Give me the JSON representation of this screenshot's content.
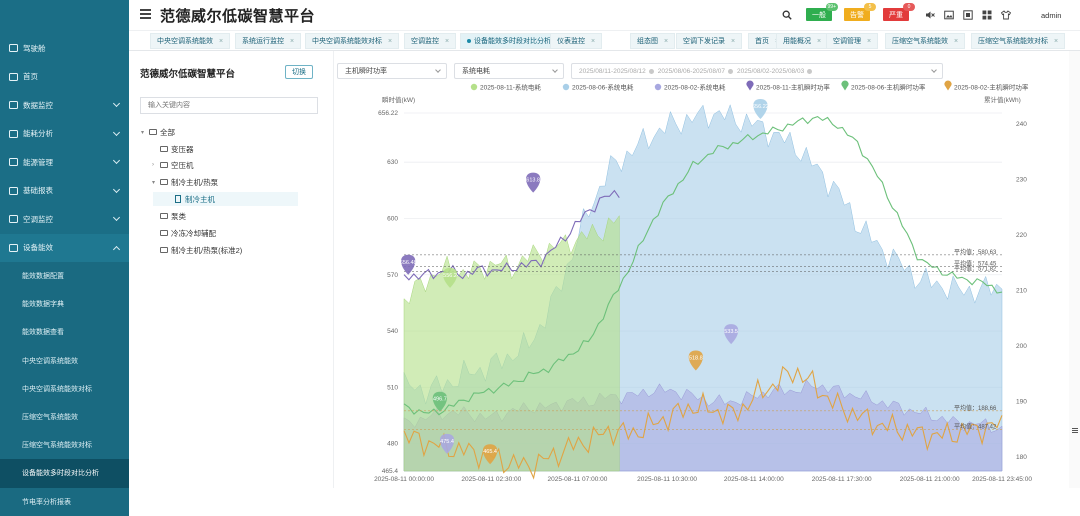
{
  "app": {
    "title": "范德威尔低碳智慧平台",
    "user": "admin"
  },
  "sidebar": {
    "items": [
      {
        "label": "驾驶舱",
        "icon": "dashboard-icon"
      },
      {
        "label": "首页",
        "icon": "home-icon"
      },
      {
        "label": "数据监控",
        "icon": "monitor-icon"
      },
      {
        "label": "能耗分析",
        "icon": "chart-icon"
      },
      {
        "label": "能源管理",
        "icon": "energy-icon"
      },
      {
        "label": "基础报表",
        "icon": "report-icon"
      },
      {
        "label": "空调监控",
        "icon": "snowflake-icon"
      },
      {
        "label": "设备能效",
        "icon": "device-icon"
      }
    ],
    "sub_items": [
      "能效数据配置",
      "能效数据字典",
      "能效数据查看",
      "中央空调系统能效",
      "中央空调系统能效对标",
      "压缩空气系统能效",
      "压缩空气系统能效对标",
      "设备能效多时段对比分析",
      "节电率分析报表"
    ],
    "active_sub": "设备能效多时段对比分析"
  },
  "header": {
    "alarms": [
      {
        "label": "一般",
        "count": "99+",
        "color": "#2fae4f"
      },
      {
        "label": "告警",
        "count": "5",
        "color": "#f0ad1e"
      },
      {
        "label": "严重",
        "count": "0",
        "color": "#e23b3b"
      }
    ],
    "icons": [
      "search-icon",
      "mute-icon",
      "image-icon",
      "fullscreen-icon",
      "grid-icon",
      "shirt-icon"
    ]
  },
  "tabs": [
    {
      "label": "中央空调系统能效",
      "active": false
    },
    {
      "label": "系统运行监控",
      "active": false
    },
    {
      "label": "中央空调系统能效对标",
      "active": false
    },
    {
      "label": "空调监控",
      "active": false
    },
    {
      "label": "设备能效多时段对比分析",
      "active": true
    },
    {
      "label": "仪表监控",
      "active": false
    },
    {
      "label": "组态图",
      "active": false
    },
    {
      "label": "空调下发记录",
      "active": false
    },
    {
      "label": "首页",
      "active": false
    },
    {
      "label": "用能概况",
      "active": false
    },
    {
      "label": "空调管理",
      "active": false
    },
    {
      "label": "压缩空气系统能效",
      "active": false
    },
    {
      "label": "压缩空气系统能效对标",
      "active": false
    }
  ],
  "tree": {
    "title": "范德威尔低碳智慧平台",
    "switch_label": "切换",
    "search_placeholder": "输入关键内容",
    "nodes": [
      {
        "label": "全部",
        "caret": "▾",
        "level": 0
      },
      {
        "label": "变压器",
        "caret": "",
        "level": 1
      },
      {
        "label": "空压机",
        "caret": "›",
        "level": 1
      },
      {
        "label": "制冷主机/热泵",
        "caret": "▾",
        "level": 1
      },
      {
        "label": "制冷主机",
        "caret": "",
        "level": 2,
        "leaf": true,
        "selected": true
      },
      {
        "label": "泵类",
        "caret": "",
        "level": 1
      },
      {
        "label": "冷冻冷却辅配",
        "caret": "",
        "level": 1
      },
      {
        "label": "制冷主机/热泵(标准2)",
        "caret": "",
        "level": 1
      }
    ]
  },
  "filters": {
    "metric_select": "主机瞬时功率",
    "metric2_select": "系统电耗",
    "date_ranges": [
      "2025/08/11-2025/08/12",
      "2025/08/06-2025/08/07",
      "2025/08/02-2025/08/03"
    ]
  },
  "chart_data": {
    "type": "line",
    "left_axis_label": "瞬时值(kW)",
    "right_axis_label": "累计值(kWh)",
    "left_ticks": [
      "656.22",
      "630",
      "600",
      "570",
      "540",
      "510",
      "480",
      "465.4"
    ],
    "left_tick_values": [
      656.22,
      630,
      600,
      570,
      540,
      510,
      480,
      465.4
    ],
    "left_range": [
      465.4,
      656.22
    ],
    "right_ticks": [
      "240",
      "230",
      "220",
      "210",
      "200",
      "190",
      "180"
    ],
    "right_range": [
      177.5,
      242
    ],
    "x_labels": [
      "2025-08-11 00:00:00",
      "2025-08-11 02:30:00",
      "2025-08-11 07:00:00",
      "2025-08-11 10:30:00",
      "2025-08-11 14:00:00",
      "2025-08-11 17:30:00",
      "2025-08-11 21:00:00",
      "2025-08-11 23:45:00"
    ],
    "legend": [
      {
        "name": "2025-08-11-系统电耗",
        "color": "#b5e08a",
        "type": "area"
      },
      {
        "name": "2025-08-06-系统电耗",
        "color": "#a9cfe8",
        "type": "area"
      },
      {
        "name": "2025-08-02-系统电耗",
        "color": "#a8a8e0",
        "type": "area"
      },
      {
        "name": "2025-08-11-主机瞬时功率",
        "color": "#7e6bb8",
        "type": "line"
      },
      {
        "name": "2025-08-06-主机瞬时功率",
        "color": "#6cc07a",
        "type": "line"
      },
      {
        "name": "2025-08-02-主机瞬时功率",
        "color": "#e0a444",
        "type": "line"
      }
    ],
    "markers": [
      {
        "text": "613.8",
        "color": "#7e6bb8",
        "t": 0.216,
        "v": 613.8
      },
      {
        "text": "656.22",
        "color": "#a9cfe8",
        "t": 0.596,
        "v": 653
      },
      {
        "text": "656.48",
        "color": "#7e6bb8",
        "t": 0.007,
        "v": 570
      },
      {
        "text": "556.2",
        "color": "#b5e08a",
        "t": 0.077,
        "v": 563
      },
      {
        "text": "496.7",
        "color": "#6cc07a",
        "t": 0.06,
        "v": 497
      },
      {
        "text": "475.4",
        "color": "#a8a8e0",
        "t": 0.072,
        "v": 474.5
      },
      {
        "text": "465.4",
        "color": "#e0a444",
        "t": 0.144,
        "v": 469
      },
      {
        "text": "518.8",
        "color": "#e0a444",
        "t": 0.488,
        "v": 519
      },
      {
        "text": "533.5",
        "color": "#a8a8e0",
        "t": 0.547,
        "v": 533
      }
    ],
    "avg_lines": [
      {
        "text": "平均值：580.63",
        "v": 580.6
      },
      {
        "text": "平均值：574.45",
        "v": 574.4
      },
      {
        "text": "平均值：571.82",
        "v": 571.8
      },
      {
        "text": "平均值：188.66",
        "v": 497.5
      },
      {
        "text": "平均值：487.42",
        "v": 487.4
      }
    ],
    "series_hourly": {
      "s0811_power": [
        570,
        569,
        571,
        572,
        570,
        573,
        572,
        574,
        575,
        578,
        586,
        595,
        604,
        611,
        614
      ],
      "s0806_power": [
        500,
        496,
        498,
        504,
        508,
        511,
        516,
        520,
        527,
        535,
        555,
        575,
        598,
        614,
        628,
        636,
        640,
        644,
        647,
        651,
        654,
        650,
        640,
        622,
        600,
        578,
        572,
        568,
        566,
        561
      ],
      "s0802_power": [
        484,
        481,
        478,
        476,
        474,
        470,
        468,
        472,
        478,
        482,
        487,
        485,
        490,
        495,
        500,
        498,
        495,
        505,
        512,
        519,
        510,
        500,
        495,
        490,
        488,
        485,
        484,
        486,
        488,
        490
      ],
      "s0811_cum": [
        208,
        211,
        213,
        214,
        213,
        214,
        215,
        214,
        216,
        217,
        218,
        219,
        220,
        221,
        223
      ],
      "s0806_cum": [
        193,
        192,
        193,
        195,
        196,
        198,
        200,
        206,
        215,
        225,
        232,
        235,
        238,
        240,
        241,
        242,
        241,
        240,
        238,
        236,
        232,
        228,
        222,
        218,
        215,
        212,
        211,
        210,
        210,
        211
      ],
      "s0802_cum": [
        186,
        187,
        188,
        188,
        187,
        188,
        189,
        189,
        190,
        190,
        191,
        191,
        192,
        192,
        191,
        190,
        190,
        191,
        192,
        192,
        193,
        192,
        191,
        190,
        189,
        188,
        187,
        186,
        186,
        185
      ]
    }
  }
}
